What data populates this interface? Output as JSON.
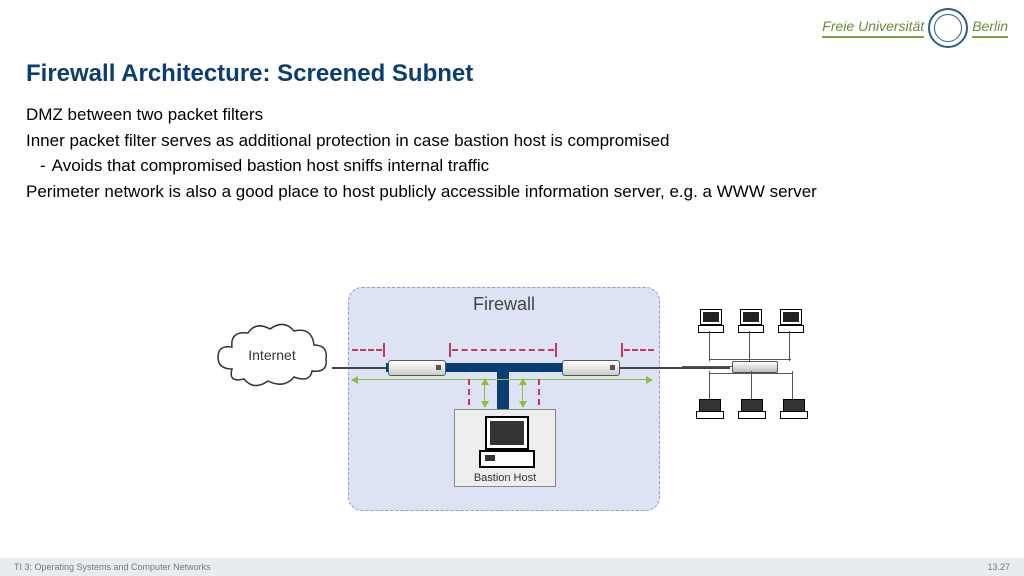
{
  "header": {
    "uni_left": "Freie Universität",
    "uni_right": "Berlin"
  },
  "title": "Firewall Architecture: Screened Subnet",
  "bullets": {
    "b1": "DMZ between two packet filters",
    "b2": "Inner packet filter serves as additional protection in case bastion host is compromised",
    "b2a": "Avoids that compromised bastion host sniffs internal traffic",
    "b3": "Perimeter network is also a good place to host publicly accessible information server, e.g. a WWW server"
  },
  "diagram": {
    "firewall_label": "Firewall",
    "internet_label": "Internet",
    "bastion_label": "Bastion Host"
  },
  "footer": {
    "left": "TI 3: Operating Systems and Computer Networks",
    "right": "13.27"
  }
}
